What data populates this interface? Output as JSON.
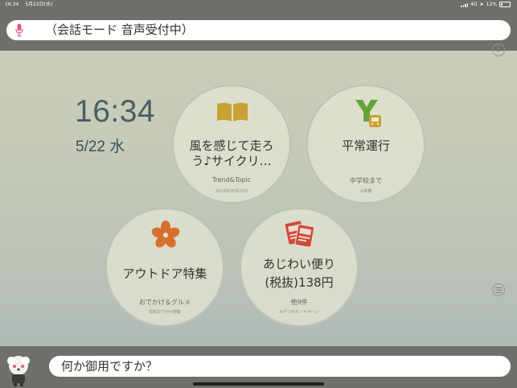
{
  "status_bar": {
    "time": "16:34",
    "date": "5月22日(水)",
    "network": "4G",
    "battery": "12%"
  },
  "voice_bar": {
    "text": "（会話モード 音声受付中）",
    "icon": "mic-icon"
  },
  "clock": {
    "time": "16:34",
    "date": "5/22 水"
  },
  "tiles": [
    {
      "title_line1": "風を感じて走ろ",
      "title_line2": "う♪サイクリ…",
      "subtitle": "Trend&Topic",
      "note": "2019年05月22日",
      "icon": "book-icon"
    },
    {
      "title_line1": "平常運行",
      "title_line2": "",
      "subtitle": "中学校まで",
      "note": "※新橋",
      "icon": "train-route-icon"
    },
    {
      "title_line1": "アウトドア特集",
      "title_line2": "",
      "subtitle": "おでかけ＆グルメ",
      "note": "週末おでかけ特集",
      "icon": "sakura-icon"
    },
    {
      "title_line1": "あじわい便り",
      "title_line2": "(税抜)138円",
      "subtitle": "他9件",
      "note": "※デジタル・イメージ",
      "icon": "flyer-cards-icon"
    }
  ],
  "query_bar": {
    "text": "何か御用ですか？"
  },
  "colors": {
    "accent_mic": "#e05f86",
    "icon_gold": "#c9a133",
    "icon_green": "#66a33b",
    "icon_orange": "#d6702d",
    "icon_red": "#cf4b38",
    "clock_color": "#4a5f66"
  }
}
